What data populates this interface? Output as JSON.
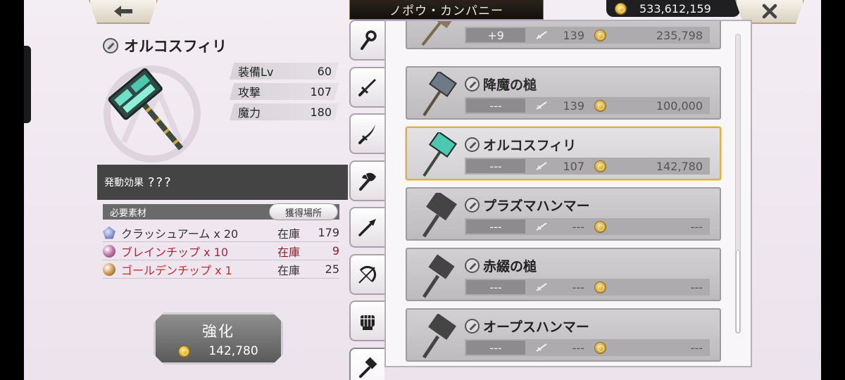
{
  "header": {
    "title": "ノポウ・カンパニー",
    "currency": "533,612,159"
  },
  "selected_item": {
    "name": "オルコスフィリ",
    "stats": [
      {
        "label": "装備Lv",
        "value": "60"
      },
      {
        "label": "攻撃",
        "value": "107"
      },
      {
        "label": "魔力",
        "value": "180"
      }
    ],
    "effect_label": "発動効果",
    "effect_value": "???"
  },
  "materials": {
    "header": "必要素材",
    "source_button": "獲得場所",
    "items": [
      {
        "name": "クラッシュアーム x 20",
        "stock_label": "在庫",
        "count": "179"
      },
      {
        "name": "ブレインチップ x 10",
        "stock_label": "在庫",
        "count": "9"
      },
      {
        "name": "ゴールデンチップ x 1",
        "stock_label": "在庫",
        "count": "25"
      }
    ]
  },
  "enhance": {
    "label": "強化",
    "cost": "142,780"
  },
  "tabs": [
    {
      "icon": "staff-icon"
    },
    {
      "icon": "sword-icon"
    },
    {
      "icon": "katana-icon"
    },
    {
      "icon": "axe-icon"
    },
    {
      "icon": "spear-icon"
    },
    {
      "icon": "bow-icon"
    },
    {
      "icon": "fist-icon"
    },
    {
      "icon": "hammer-icon"
    }
  ],
  "weapons": [
    {
      "name": "",
      "plus": "+9",
      "attack": "139",
      "price": "235,798"
    },
    {
      "name": "降魔の槌",
      "plus": "---",
      "attack": "139",
      "price": "100,000"
    },
    {
      "name": "オルコスフィリ",
      "plus": "---",
      "attack": "107",
      "price": "142,780"
    },
    {
      "name": "プラズマハンマー",
      "plus": "---",
      "attack": "---",
      "price": "---"
    },
    {
      "name": "赤綴の槌",
      "plus": "---",
      "attack": "---",
      "price": "---"
    },
    {
      "name": "オープスハンマー",
      "plus": "---",
      "attack": "---",
      "price": "---"
    }
  ],
  "colors": {
    "accent_gold": "#d9b04a",
    "shortage_red": "#a8283a",
    "banner_dark": "#1a1510"
  }
}
